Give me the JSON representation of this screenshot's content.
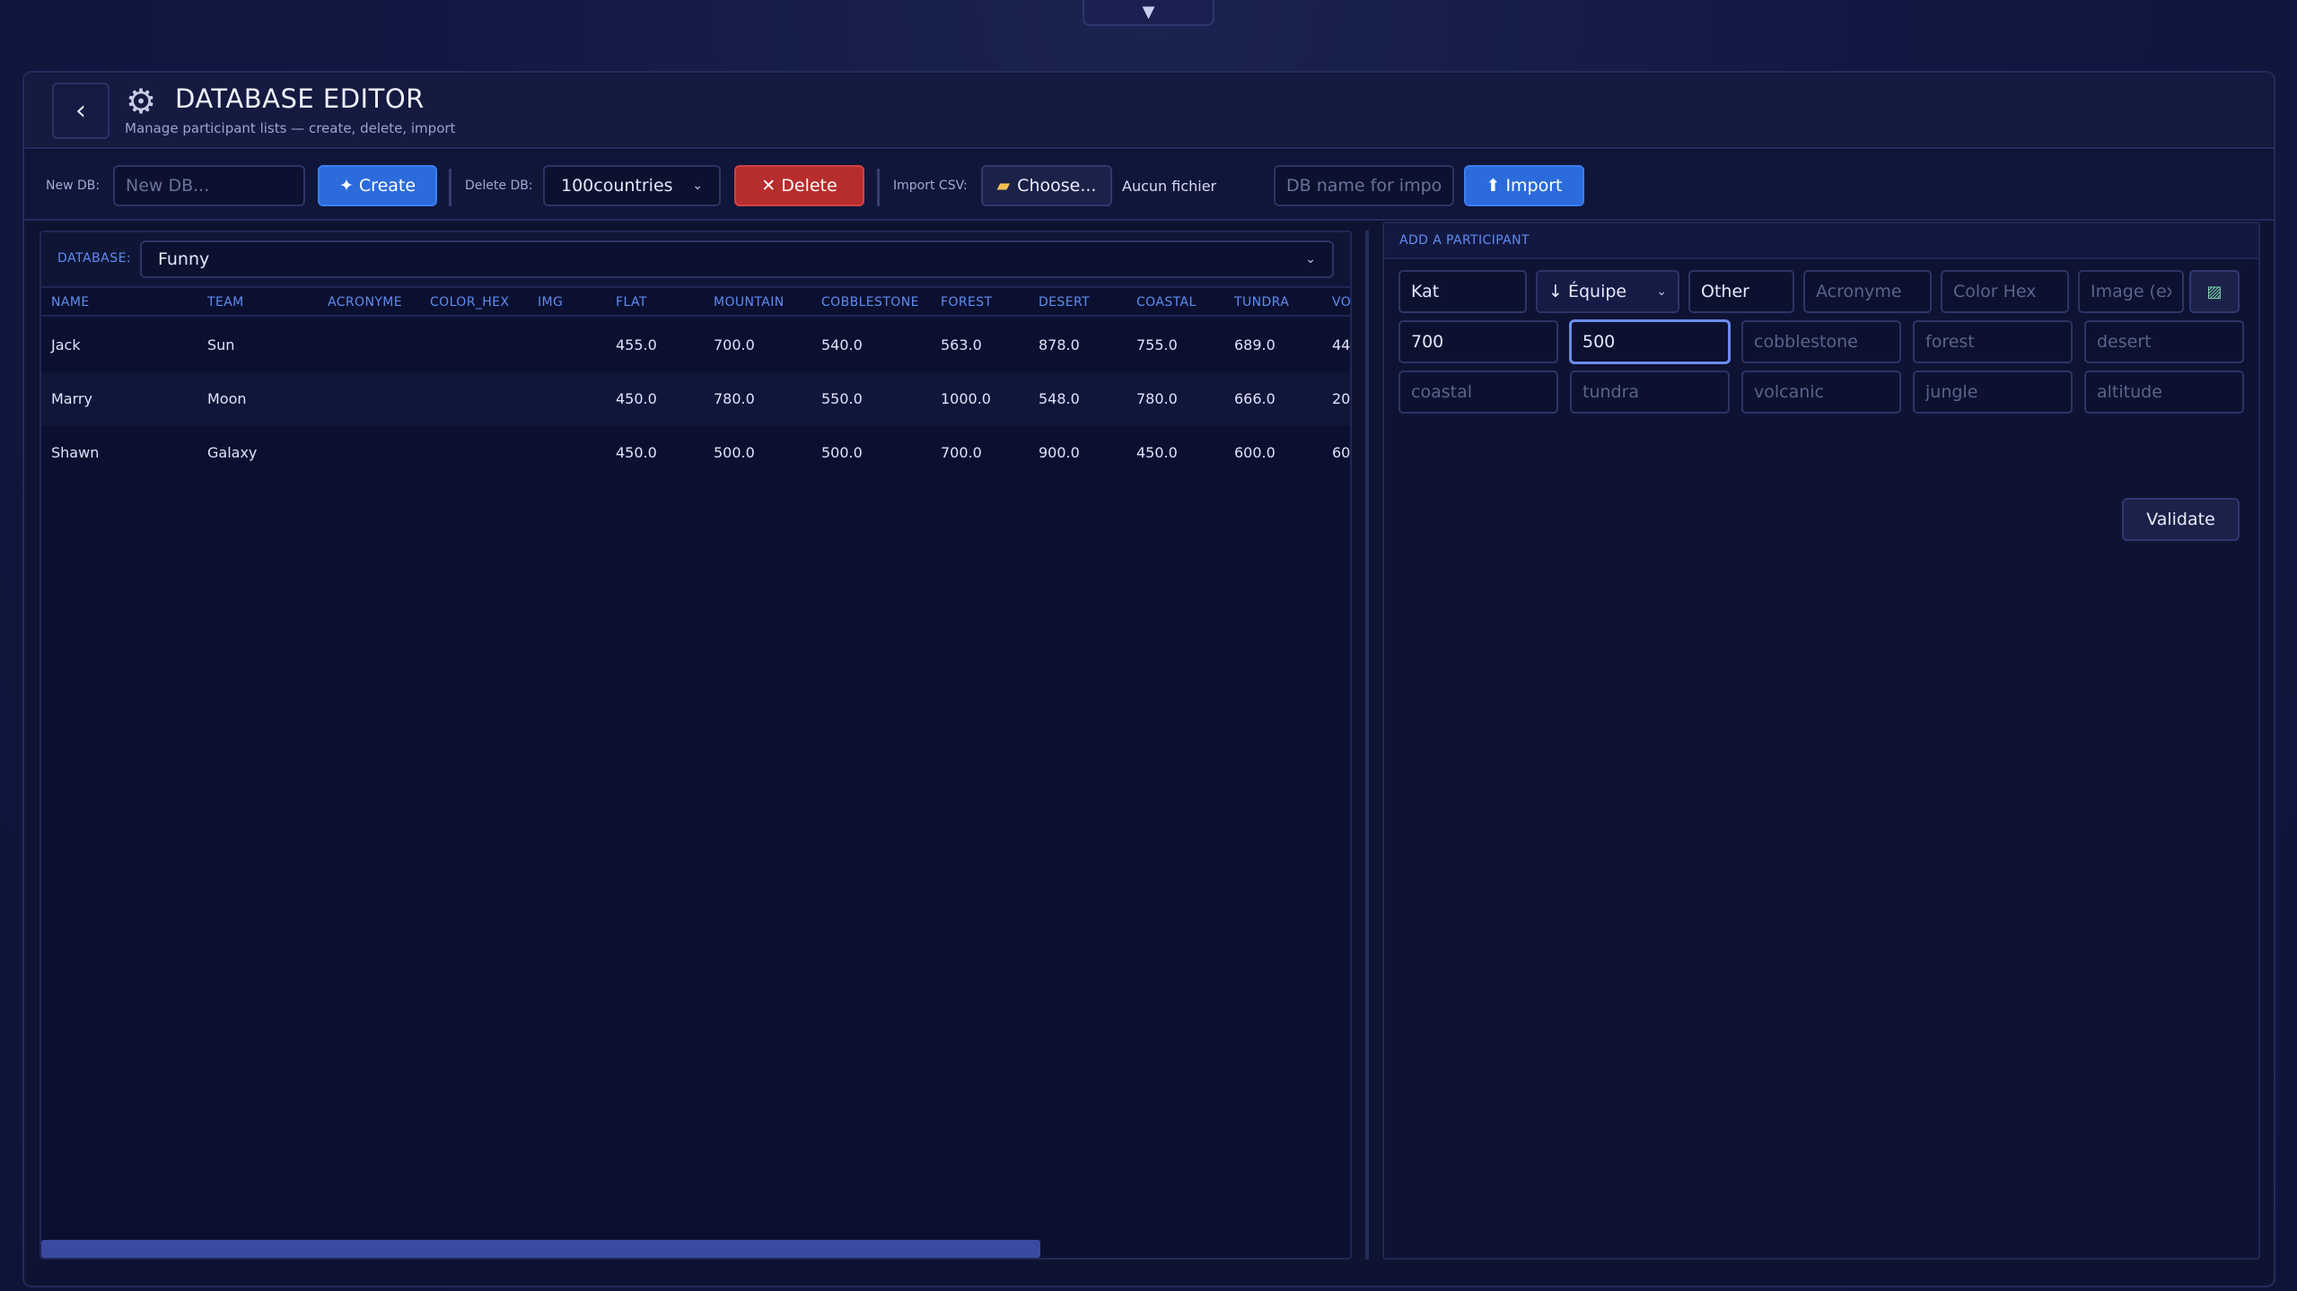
{
  "header": {
    "title": "DATABASE EDITOR",
    "subtitle": "Manage participant lists — create, delete, import",
    "top_toggle": "▼"
  },
  "toolbar": {
    "new_db_label": "New DB:",
    "new_db_placeholder": "New DB...",
    "create_label": "✦ Create",
    "delete_db_label": "Delete DB:",
    "delete_db_selected": "100countries",
    "delete_label": "✕ Delete",
    "import_csv_label": "Import CSV:",
    "choose_label": "Choose...",
    "no_file_text": "Aucun fichier",
    "db_import_placeholder": "DB name for import",
    "import_label": "⬆ Import"
  },
  "table": {
    "database_label": "DATABASE:",
    "database_selected": "Funny",
    "columns": [
      "NAME",
      "TEAM",
      "ACRONYME",
      "COLOR_HEX",
      "IMG",
      "FLAT",
      "MOUNTAIN",
      "COBBLESTONE",
      "FOREST",
      "DESERT",
      "COASTAL",
      "TUNDRA",
      "VO"
    ],
    "rows": [
      [
        "Jack",
        "Sun",
        "",
        "",
        "",
        "455.0",
        "700.0",
        "540.0",
        "563.0",
        "878.0",
        "755.0",
        "689.0",
        "44"
      ],
      [
        "Marry",
        "Moon",
        "",
        "",
        "",
        "450.0",
        "780.0",
        "550.0",
        "1000.0",
        "548.0",
        "780.0",
        "666.0",
        "20"
      ],
      [
        "Shawn",
        "Galaxy",
        "",
        "",
        "",
        "450.0",
        "500.0",
        "500.0",
        "700.0",
        "900.0",
        "450.0",
        "600.0",
        "60"
      ]
    ]
  },
  "form": {
    "title": "ADD A PARTICIPANT",
    "name_value": "Kat",
    "team_label": "↓ Équipe",
    "other_value": "Other",
    "acronyme_placeholder": "Acronyme",
    "color_placeholder": "Color Hex",
    "image_placeholder": "Image (ex",
    "flat_value": "700",
    "mountain_value": "500",
    "cobblestone_placeholder": "cobblestone",
    "forest_placeholder": "forest",
    "desert_placeholder": "desert",
    "coastal_placeholder": "coastal",
    "tundra_placeholder": "tundra",
    "volcanic_placeholder": "volcanic",
    "jungle_placeholder": "jungle",
    "altitude_placeholder": "altitude",
    "validate_label": "Validate"
  },
  "icons": [
    "chevron-left-icon",
    "gear-icon",
    "folder-icon",
    "image-icon",
    "chevron-down-icon"
  ]
}
